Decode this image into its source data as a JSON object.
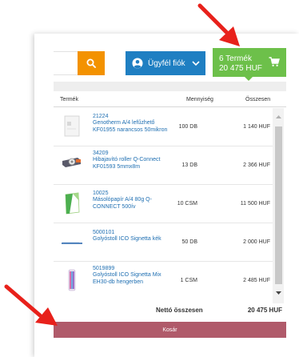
{
  "header": {
    "account_label": "Ügyfél fiók",
    "cart_count": "6 Termék",
    "cart_total": "20 475 HUF"
  },
  "table": {
    "col_product": "Termék",
    "col_quantity": "Mennyiség",
    "col_total": "Összesen"
  },
  "items": [
    {
      "code": "21224",
      "name": "Genotherm A/4 lefűzhető KF01955 narancsos 50mikron",
      "quantity": "100 DB",
      "total": "1 140 HUF"
    },
    {
      "code": "34209",
      "name": "Hibajavító roller Q-Connect KF01593 5mmx8m",
      "quantity": "13 DB",
      "total": "2 366 HUF"
    },
    {
      "code": "10025",
      "name": "Másolópapír A/4 80g Q-CONNECT 500ív",
      "quantity": "10 CSM",
      "total": "11 500 HUF"
    },
    {
      "code": "5000101",
      "name": "Golyóstoll ICO Signetta kék",
      "quantity": "50 DB",
      "total": "2 000 HUF"
    },
    {
      "code": "5019899",
      "name": "Golyóstoll ICO Signetta Mix EH30-db hengerben",
      "quantity": "1 CSM",
      "total": "2 485 HUF"
    }
  ],
  "footer": {
    "net_label": "Nettó összesen",
    "net_value": "20 475 HUF",
    "checkout_label": "Kosár"
  },
  "colors": {
    "search": "#f39200",
    "account": "#1f7fc2",
    "cart": "#6dc04a",
    "checkout": "#b05a6a",
    "link": "#1f6fb2",
    "annotation_arrow": "#e8211b"
  },
  "icons": {
    "search": "search-icon",
    "account": "user-circle-icon",
    "dropdown": "chevron-down-icon",
    "cart": "cart-icon"
  }
}
